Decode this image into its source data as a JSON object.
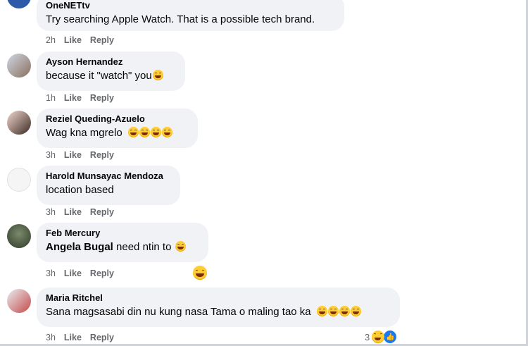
{
  "comments": [
    {
      "author": "OneNETtv",
      "text": "Try searching Apple Watch. That is a possible tech brand.",
      "time": "2h",
      "like": "Like",
      "reply": "Reply"
    },
    {
      "author": "Ayson Hernandez",
      "text": "because it \"watch\" you",
      "time": "1h",
      "like": "Like",
      "reply": "Reply"
    },
    {
      "author": "Reziel Queding-Azuelo",
      "text": "Wag kna mgrelo",
      "time": "3h",
      "like": "Like",
      "reply": "Reply"
    },
    {
      "author": "Harold Munsayac Mendoza",
      "text": "location based",
      "time": "3h",
      "like": "Like",
      "reply": "Reply"
    },
    {
      "author": "Feb Mercury",
      "mention": "Angela Bugal",
      "text": " need ntin to",
      "time": "3h",
      "like": "Like",
      "reply": "Reply"
    },
    {
      "author": "Maria Ritchel",
      "text": "Sana magsasabi din nu kung nasa Tama o maling tao ka",
      "time": "3h",
      "like": "Like",
      "reply": "Reply",
      "reaction_count": "3"
    }
  ],
  "colors": {
    "bubble": "#f0f2f5",
    "meta": "#65676b",
    "like_blue": "#1877f2"
  },
  "icons": [
    "laughing-emoji-icon",
    "thumbs-up-icon"
  ]
}
